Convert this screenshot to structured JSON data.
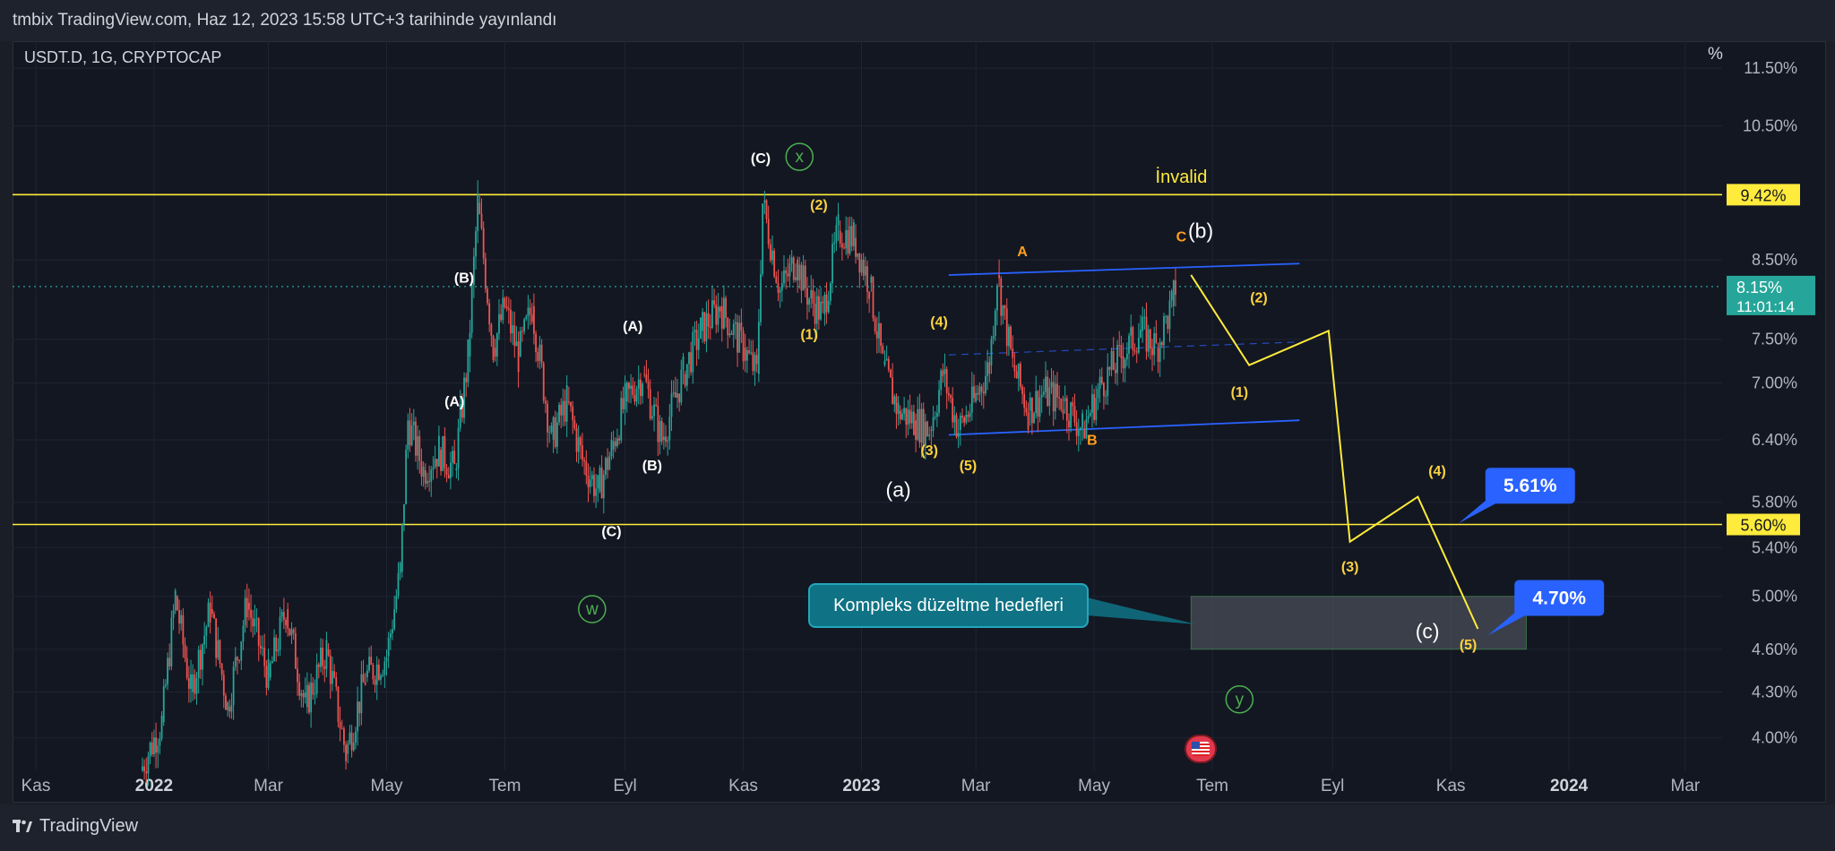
{
  "header": {
    "publish_text": "tmbix TradingView.com, Haz 12, 2023 15:58 UTC+3 tarihinde yayınlandı"
  },
  "chart": {
    "symbol_legend": "USDT.D, 1G, CRYPTOCAP",
    "unit_label": "%"
  },
  "footer": {
    "brand": "TradingView"
  },
  "callout": {
    "text": "Kompleks düzeltme hedefleri"
  },
  "colors": {
    "background": "#131722",
    "up_candle": "#26a69a",
    "down_candle": "#ef5350",
    "level_line": "#ffeb3b",
    "channel": "#2962ff",
    "wave_label_yellow": "#ffd23f",
    "wave_label_orange": "#ff9f1c",
    "circle_label": "#4caf50",
    "price_tag": "#26a69a",
    "target_tag": "#2962ff"
  },
  "chart_data": {
    "type": "candlestick",
    "title": "USDT.D, 1G, CRYPTOCAP",
    "y_unit": "%",
    "y_scale": "log",
    "y_ticks": [
      "11.50%",
      "10.50%",
      "8.50%",
      "7.50%",
      "7.00%",
      "6.40%",
      "5.80%",
      "5.40%",
      "5.00%",
      "4.60%",
      "4.30%",
      "4.00%"
    ],
    "x_ticks": [
      "Kas",
      "2022",
      "Mar",
      "May",
      "Tem",
      "Eyl",
      "Kas",
      "2023",
      "Mar",
      "May",
      "Tem",
      "Eyl",
      "Kas",
      "2024",
      "Mar"
    ],
    "ylim": [
      3.8,
      12.0
    ],
    "xlim": [
      "2021-10-20",
      "2024-03-20"
    ],
    "grid": true,
    "current_price": {
      "value": "8.15%",
      "countdown": "11:01:14"
    },
    "horizontal_levels": [
      {
        "value": 9.42,
        "label": "9.42%"
      },
      {
        "value": 5.6,
        "label": "5.60%"
      }
    ],
    "text_annotations": [
      {
        "text": "İnvalid",
        "date": "2023-06-15",
        "price": 9.6
      },
      {
        "text": "(b)",
        "date": "2023-06-25",
        "price": 8.8
      },
      {
        "text": "(a)",
        "date": "2023-01-20",
        "price": 5.85
      },
      {
        "text": "(c)",
        "date": "2023-10-20",
        "price": 4.68
      }
    ],
    "wave_labels_white": [
      {
        "text": "(B)",
        "date": "2022-06-10",
        "price": 8.2
      },
      {
        "text": "(A)",
        "date": "2022-06-05",
        "price": 6.75
      },
      {
        "text": "(C)",
        "date": "2022-08-25",
        "price": 5.5
      },
      {
        "text": "(A)",
        "date": "2022-09-05",
        "price": 7.6
      },
      {
        "text": "(B)",
        "date": "2022-09-15",
        "price": 6.1
      },
      {
        "text": "(C)",
        "date": "2022-11-10",
        "price": 9.9
      }
    ],
    "wave_labels_yellow": [
      {
        "text": "(2)",
        "date": "2022-12-10",
        "price": 9.2
      },
      {
        "text": "(1)",
        "date": "2022-12-05",
        "price": 7.5
      },
      {
        "text": "(4)",
        "date": "2023-02-10",
        "price": 7.65
      },
      {
        "text": "(3)",
        "date": "2023-02-05",
        "price": 6.25
      },
      {
        "text": "(5)",
        "date": "2023-02-25",
        "price": 6.1
      },
      {
        "text": "(2)",
        "date": "2023-07-25",
        "price": 7.95
      },
      {
        "text": "(1)",
        "date": "2023-07-15",
        "price": 6.85
      },
      {
        "text": "(4)",
        "date": "2023-10-25",
        "price": 6.05
      },
      {
        "text": "(3)",
        "date": "2023-09-10",
        "price": 5.2
      },
      {
        "text": "(5)",
        "date": "2023-11-10",
        "price": 4.6
      }
    ],
    "wave_labels_orange": [
      {
        "text": "A",
        "date": "2023-03-25",
        "price": 8.55
      },
      {
        "text": "B",
        "date": "2023-04-30",
        "price": 6.35
      },
      {
        "text": "C",
        "date": "2023-06-15",
        "price": 8.75
      }
    ],
    "circle_labels": [
      {
        "text": "x",
        "date": "2022-11-30",
        "price": 10.0
      },
      {
        "text": "w",
        "date": "2022-08-15",
        "price": 4.9
      },
      {
        "text": "y",
        "date": "2023-07-15",
        "price": 4.25
      }
    ],
    "targets": [
      {
        "label": "5.61%",
        "value": 5.61
      },
      {
        "label": "4.70%",
        "value": 4.7
      }
    ],
    "projection_path": [
      {
        "date": "2023-06-20",
        "price": 8.3
      },
      {
        "date": "2023-07-20",
        "price": 7.2
      },
      {
        "date": "2023-08-30",
        "price": 7.6
      },
      {
        "date": "2023-09-10",
        "price": 5.45
      },
      {
        "date": "2023-10-15",
        "price": 5.85
      },
      {
        "date": "2023-11-15",
        "price": 4.75
      }
    ],
    "channel": {
      "upper": [
        {
          "date": "2023-02-15",
          "price": 8.3
        },
        {
          "date": "2023-08-15",
          "price": 8.45
        }
      ],
      "lower": [
        {
          "date": "2023-02-15",
          "price": 6.45
        },
        {
          "date": "2023-08-15",
          "price": 6.6
        }
      ]
    },
    "target_zone": {
      "date_from": "2023-06-20",
      "date_to": "2023-12-10",
      "price_from": 4.6,
      "price_to": 5.0
    },
    "series": [
      {
        "name": "USDT.D",
        "points": [
          [
            "2021-12-25",
            3.8
          ],
          [
            "2022-01-05",
            4.1
          ],
          [
            "2022-01-12",
            5.0
          ],
          [
            "2022-01-20",
            4.3
          ],
          [
            "2022-01-30",
            4.9
          ],
          [
            "2022-02-08",
            4.2
          ],
          [
            "2022-02-18",
            4.95
          ],
          [
            "2022-03-01",
            4.4
          ],
          [
            "2022-03-10",
            4.9
          ],
          [
            "2022-03-20",
            4.2
          ],
          [
            "2022-03-31",
            4.6
          ],
          [
            "2022-04-10",
            3.9
          ],
          [
            "2022-04-20",
            4.4
          ],
          [
            "2022-05-01",
            4.55
          ],
          [
            "2022-05-08",
            5.2
          ],
          [
            "2022-05-12",
            6.6
          ],
          [
            "2022-05-20",
            6.1
          ],
          [
            "2022-05-28",
            6.3
          ],
          [
            "2022-06-05",
            6.1
          ],
          [
            "2022-06-12",
            7.3
          ],
          [
            "2022-06-17",
            9.3
          ],
          [
            "2022-06-25",
            7.4
          ],
          [
            "2022-07-01",
            7.9
          ],
          [
            "2022-07-08",
            7.3
          ],
          [
            "2022-07-15",
            7.9
          ],
          [
            "2022-07-25",
            6.4
          ],
          [
            "2022-08-02",
            6.8
          ],
          [
            "2022-08-10",
            6.2
          ],
          [
            "2022-08-18",
            5.9
          ],
          [
            "2022-08-25",
            6.3
          ],
          [
            "2022-09-01",
            6.8
          ],
          [
            "2022-09-10",
            7.1
          ],
          [
            "2022-09-20",
            6.4
          ],
          [
            "2022-10-01",
            7.1
          ],
          [
            "2022-10-10",
            7.6
          ],
          [
            "2022-10-20",
            7.9
          ],
          [
            "2022-11-01",
            7.4
          ],
          [
            "2022-11-08",
            7.1
          ],
          [
            "2022-11-11",
            9.3
          ],
          [
            "2022-11-20",
            8.1
          ],
          [
            "2022-11-28",
            8.5
          ],
          [
            "2022-12-05",
            8.0
          ],
          [
            "2022-12-12",
            7.8
          ],
          [
            "2022-12-20",
            8.9
          ],
          [
            "2022-12-28",
            8.8
          ],
          [
            "2023-01-05",
            8.2
          ],
          [
            "2023-01-12",
            7.2
          ],
          [
            "2023-01-20",
            6.7
          ],
          [
            "2023-01-28",
            6.6
          ],
          [
            "2023-02-05",
            6.5
          ],
          [
            "2023-02-12",
            7.1
          ],
          [
            "2023-02-20",
            6.5
          ],
          [
            "2023-02-28",
            6.8
          ],
          [
            "2023-03-08",
            7.2
          ],
          [
            "2023-03-12",
            8.3
          ],
          [
            "2023-03-20",
            7.2
          ],
          [
            "2023-03-28",
            6.7
          ],
          [
            "2023-04-05",
            6.9
          ],
          [
            "2023-04-15",
            6.8
          ],
          [
            "2023-04-25",
            6.5
          ],
          [
            "2023-05-05",
            7.0
          ],
          [
            "2023-05-15",
            7.3
          ],
          [
            "2023-05-25",
            7.6
          ],
          [
            "2023-06-02",
            7.4
          ],
          [
            "2023-06-10",
            7.9
          ],
          [
            "2023-06-12",
            8.15
          ]
        ]
      }
    ]
  }
}
